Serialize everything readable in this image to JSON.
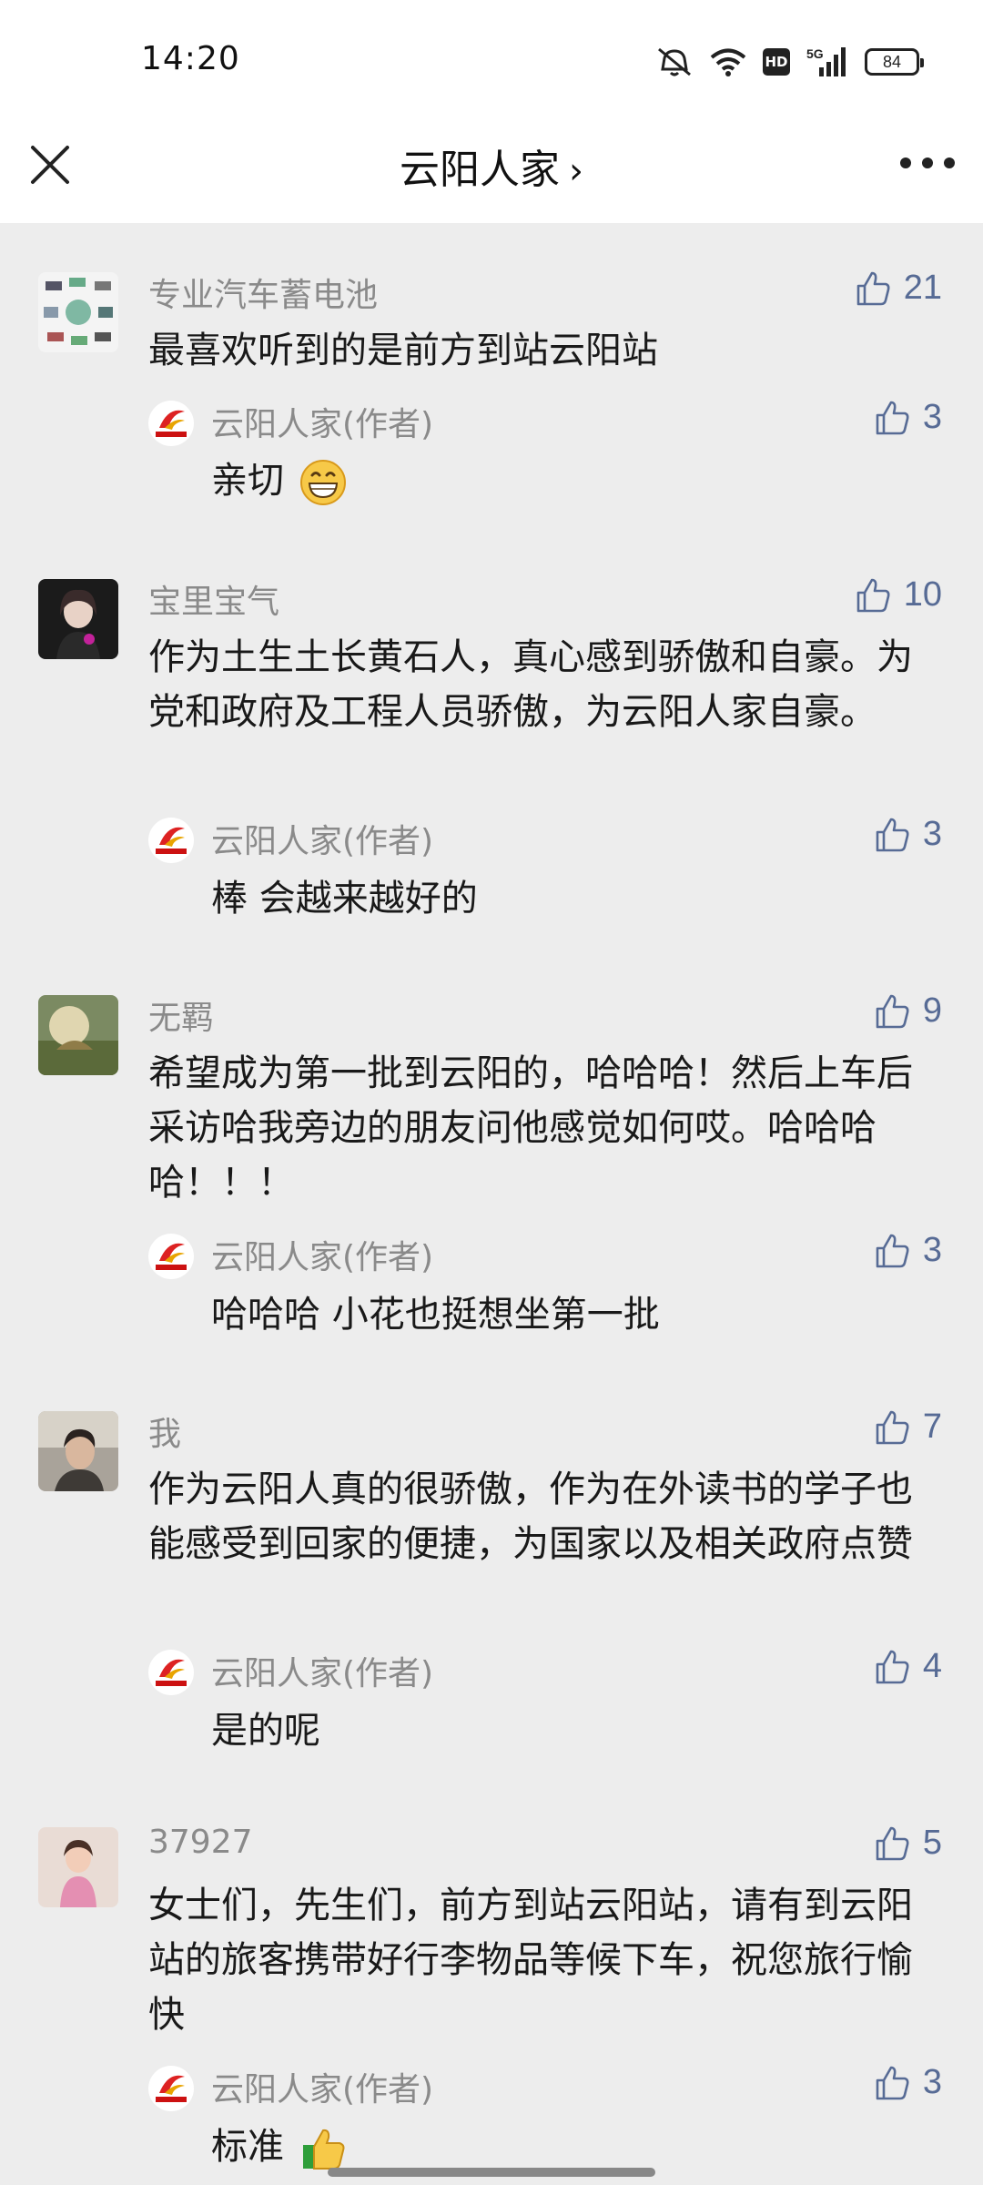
{
  "status": {
    "time": "14:20",
    "network": "5G",
    "hd": "HD",
    "battery": "84"
  },
  "nav": {
    "title": "云阳人家",
    "chevron": "›"
  },
  "comments": [
    {
      "nickname": "专业汽车蓄电池",
      "likes": "21",
      "text": "最喜欢听到的是前方到站云阳站",
      "reply": {
        "nickname": "云阳人家(作者)",
        "likes": "3",
        "text": "亲切"
      }
    },
    {
      "nickname": "宝里宝气",
      "likes": "10",
      "text": "作为土生土长黄石人，真心感到骄傲和自豪。为党和政府及工程人员骄傲，为云阳人家自豪。",
      "reply": {
        "nickname": "云阳人家(作者)",
        "likes": "3",
        "text": "棒 会越来越好的"
      }
    },
    {
      "nickname": "无羁",
      "likes": "9",
      "text": "希望成为第一批到云阳的，哈哈哈！然后上车后采访哈我旁边的朋友问他感觉如何哎。哈哈哈哈！！！",
      "reply": {
        "nickname": "云阳人家(作者)",
        "likes": "3",
        "text": "哈哈哈 小花也挺想坐第一批"
      }
    },
    {
      "nickname": "我",
      "likes": "7",
      "text": "作为云阳人真的很骄傲，作为在外读书的学子也能感受到回家的便捷，为国家以及相关政府点赞",
      "reply": {
        "nickname": "云阳人家(作者)",
        "likes": "4",
        "text": "是的呢"
      }
    },
    {
      "nickname": "37927",
      "likes": "5",
      "text": "女士们，先生们，前方到站云阳站，请有到云阳站的旅客携带好行李物品等候下车，祝您旅行愉快",
      "reply": {
        "nickname": "云阳人家(作者)",
        "likes": "3",
        "text": "标准"
      }
    }
  ],
  "icons": {
    "close": "close-icon",
    "more": "more-icon",
    "like": "thumbs-up-icon",
    "emoji_grin": "grinning-emoji-icon",
    "emoji_thumb": "thumbs-up-emoji-icon"
  },
  "colors": {
    "link_blue": "#576b95",
    "nick_gray": "#8a8a8a",
    "bg": "#ededed"
  }
}
